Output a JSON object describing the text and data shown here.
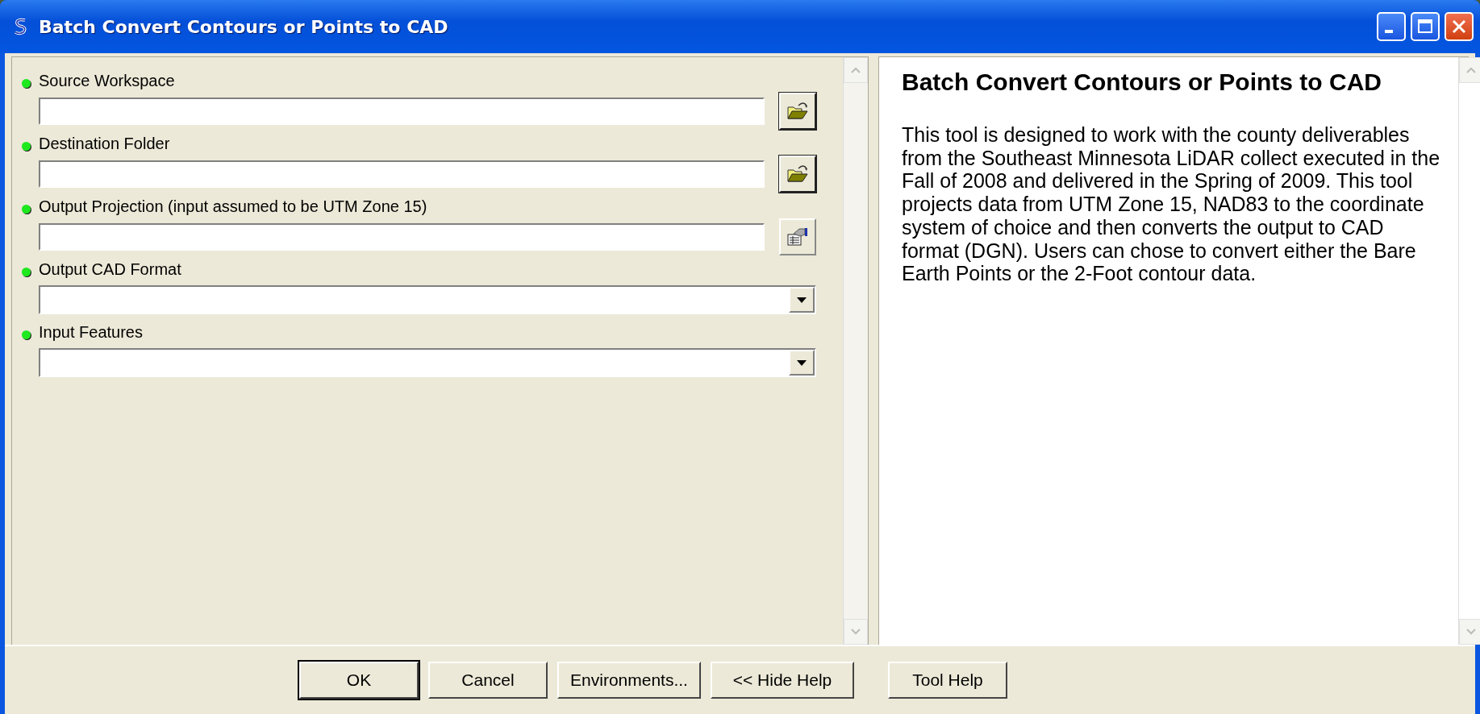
{
  "window": {
    "title": "Batch Convert Contours or Points to CAD"
  },
  "fields": [
    {
      "label": "Source Workspace",
      "required": true,
      "kind": "text",
      "button": {
        "kind": "folder"
      }
    },
    {
      "label": "Destination Folder",
      "required": true,
      "kind": "text",
      "button": {
        "kind": "folder"
      }
    },
    {
      "label": "Output Projection (input assumed to be UTM Zone 15)",
      "required": true,
      "kind": "text",
      "button": {
        "kind": "properties"
      }
    },
    {
      "label": "Output CAD Format",
      "required": true,
      "kind": "dropdown"
    },
    {
      "label": "Input Features",
      "required": true,
      "kind": "dropdown"
    }
  ],
  "help": {
    "title": "Batch Convert Contours or Points to CAD",
    "text": "This tool is designed to work with the county deliverables from the Southeast Minnesota LiDAR collect executed in the Fall of 2008 and delivered in the Spring of 2009. This tool projects data from UTM Zone 15, NAD83 to the coordinate system of choice and then converts the output to CAD format (DGN). Users can chose to convert either the Bare Earth Points or the 2-Foot contour data."
  },
  "buttons": [
    {
      "label": "OK",
      "default": true
    },
    {
      "label": "Cancel",
      "default": false
    },
    {
      "label": "Environments...",
      "default": false
    },
    {
      "label": "<< Hide Help",
      "default": false
    },
    {
      "label": "Tool Help",
      "default": false
    }
  ]
}
